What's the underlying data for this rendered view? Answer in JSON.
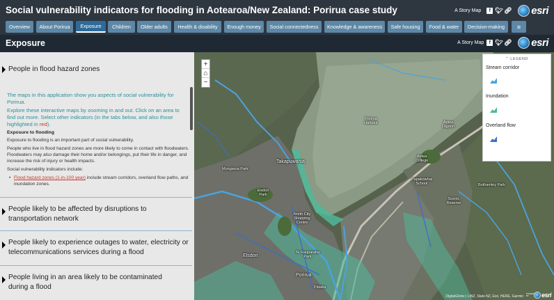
{
  "app": {
    "title": "Social vulnerability indicators for flooding in Aotearoa/New Zealand: Porirua case study",
    "story_map_label": "A Story Map",
    "brand": "esri"
  },
  "tabs": [
    {
      "label": "Overview"
    },
    {
      "label": "About Porirua"
    },
    {
      "label": "Exposure",
      "active": true
    },
    {
      "label": "Children"
    },
    {
      "label": "Older adults"
    },
    {
      "label": "Health & disability"
    },
    {
      "label": "Enough money"
    },
    {
      "label": "Social connectedness"
    },
    {
      "label": "Knowledge & awareness"
    },
    {
      "label": "Safe housing"
    },
    {
      "label": "Food & water"
    },
    {
      "label": "Decision-making"
    }
  ],
  "section": {
    "title": "Exposure",
    "story_map_label": "A Story Map",
    "brand": "esri"
  },
  "panel": {
    "sections": [
      {
        "label": "People in flood hazard zones"
      },
      {
        "label": "People likely to be affected by disruptions to transportation network"
      },
      {
        "label": "People likely to experience outages to water, electricity or telecommunications services during a flood"
      },
      {
        "label": "People living in an area likely to be contaminated during a flood"
      }
    ],
    "intro1": "The maps in this application show you aspects of social vulnerability for Porirua.",
    "intro2a": "Explore these interactive maps by zooming in and out. Click on an area to find out more. Select other indicators (in the tabs below, and also those highlighted in ",
    "intro2_red": "red",
    "intro2b": ").",
    "heading": "Exposure to flooding",
    "p1": "Exposure to flooding is an important part of social vulnerability.",
    "p2": "People who live in flood hazard zones are more likely to come in contact with floodwaters. Floodwaters may also damage their home and/or belongings, put their life in danger, and increase the risk of injury or health impacts.",
    "p3": "Social vulnerability indicators include:",
    "bullet_link": "Flood hazard zones (1-in-100 year)",
    "bullet_rest": " include stream corridors, overland flow paths, and inundation zones."
  },
  "map": {
    "zoom_in": "+",
    "home": "⌂",
    "zoom_out": "−",
    "places": {
      "porirua_harbour": "Porirua Harbour",
      "takapuwahia": "Takapuwahia",
      "elsdon": "Elsdon",
      "porirua": "Porirua",
      "mungaroa": "Mungaroa Park",
      "elsdon_park": "Elsdon Park",
      "north_city": "North City Shopping Centre",
      "te_rauparaha": "Te Rauparaha Park",
      "pataka": "Pātaka",
      "aotea": "Aotea Lagoon",
      "aotea_college": "Aotea College",
      "papakowhai": "Papakowhai School",
      "bothamley": "Bothamley Park",
      "reserve": "Scenic Reserve"
    },
    "attribution": "DigitalGlobe | LINZ, Stats NZ, Esri, HERE, Garmin",
    "logo_powered": "POWERED BY",
    "logo": "esri"
  },
  "legend": {
    "title": "LEGEND",
    "items": [
      {
        "label": "Stream corridor",
        "color": "#4aa3df"
      },
      {
        "label": "Inundation",
        "color": "#4fb89a"
      },
      {
        "label": "Overland flow",
        "color": "#3a6fc6"
      }
    ]
  },
  "colors": {
    "header_bg": "#2e3640",
    "tab_bg": "#5d87a6",
    "tab_active": "#2f6a99",
    "panel_bg": "#e8e8e8",
    "teal_text": "#2a8f9a"
  }
}
